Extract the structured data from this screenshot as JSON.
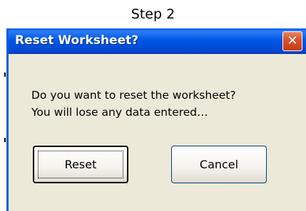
{
  "caption": "Step 2",
  "dialog": {
    "title": "Reset Worksheet?",
    "close_glyph": "✕",
    "message_line1": "Do you want to reset the worksheet?",
    "message_line2": "You will lose any data entered…",
    "buttons": {
      "reset_label": "Reset",
      "cancel_label": "Cancel"
    },
    "default_button": "Reset"
  },
  "colors": {
    "titlebar": "#0058e6",
    "close_button": "#d9542b",
    "dialog_face": "#ece9d8"
  },
  "icons": [
    "close-icon"
  ]
}
